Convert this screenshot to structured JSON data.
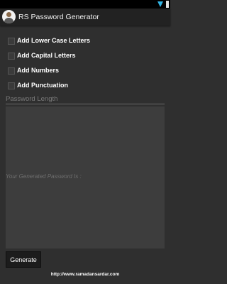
{
  "status_bar": {
    "icons": [
      "wifi-icon",
      "battery-icon"
    ],
    "accent_color": "#33b5e5"
  },
  "action_bar": {
    "title": "RS Password Generator",
    "icon": "app-avatar-icon"
  },
  "options": [
    {
      "label": "Add Lower Case Letters",
      "checked": false
    },
    {
      "label": "Add Capital Letters",
      "checked": false
    },
    {
      "label": "Add Numbers",
      "checked": false
    },
    {
      "label": "Add Punctuation",
      "checked": false
    }
  ],
  "password_length": {
    "placeholder": "Password Length",
    "value": ""
  },
  "output": {
    "label": "Your Generated Password Is :"
  },
  "actions": {
    "generate_label": "Generate"
  },
  "footer": {
    "link_text": "http://www.ramadansardar.com"
  }
}
